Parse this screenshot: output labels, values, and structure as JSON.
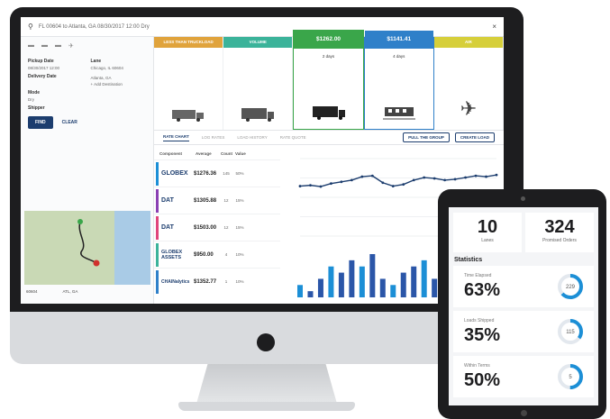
{
  "app": {
    "search_text": "FL 00604 to Atlanta, GA 08/30/2017 12:00 Dry"
  },
  "left_panel": {
    "pickup_label": "Pickup Date",
    "pickup_value": "08/30/2017 12:00",
    "lane_label": "Lane",
    "lane_origin": "Chicago, IL 60604",
    "lane_dest": "Atlanta, GA",
    "delivery_label": "Delivery Date",
    "add_destination": "+ Add Destination",
    "mode_label": "Mode",
    "mode_value": "Dry",
    "shipper_label": "Shipper",
    "find_label": "FIND",
    "clear_label": "CLEAR",
    "map_from": "60604",
    "map_to": "ATL, GA"
  },
  "mode_cards": [
    {
      "label": "LESS THAN TRUCKLOAD",
      "color": "#e0a33c"
    },
    {
      "label": "VOLUME",
      "color": "#3bb39a"
    },
    {
      "label": "$1262.00",
      "sub": "TRUCKLOAD",
      "days": "2 days",
      "color": "#3aa64a"
    },
    {
      "label": "$1141.41",
      "sub": "INTERMODAL",
      "days": "4 days",
      "color": "#2f80c9"
    },
    {
      "label": "AIR",
      "color": "#d6cf3a"
    }
  ],
  "tabs": [
    "RATE CHART",
    "LOG RATES",
    "LOAD HISTORY",
    "RATE QUOTE"
  ],
  "actions": {
    "pull_group": "PULL THE GROUP",
    "create_load": "CREATE LOAD"
  },
  "rate_headers": [
    "Component",
    "Average",
    "Count",
    "Value"
  ],
  "rates": [
    {
      "logo": "GLOBEX",
      "price": "$1276.36",
      "count": "145",
      "value": "50%",
      "color": "#1c8fd6"
    },
    {
      "logo": "DAT",
      "price": "$1305.88",
      "count": "12",
      "value": "15%",
      "color": "#8a3fb3"
    },
    {
      "logo": "DAT",
      "price": "$1503.00",
      "count": "12",
      "value": "15%",
      "color": "#e0457b"
    },
    {
      "logo": "GLOBEX ASSETS",
      "price": "$950.00",
      "count": "4",
      "value": "10%",
      "color": "#3bb39a"
    },
    {
      "logo": "CHAINalytics",
      "price": "$1352.77",
      "count": "1",
      "value": "10%",
      "color": "#2f80c9"
    }
  ],
  "tablet": {
    "lanes_value": "10",
    "lanes_label": "Lanes",
    "orders_value": "324",
    "orders_label": "Promised Orders",
    "section_title": "Statistics",
    "stats": [
      {
        "label": "Time Elapsed",
        "value": "63%",
        "ring": "229",
        "fraction": 0.63
      },
      {
        "label": "Loads Shipped",
        "value": "35%",
        "ring": "115",
        "fraction": 0.35
      },
      {
        "label": "Within Terms",
        "value": "50%",
        "ring": "5",
        "fraction": 0.5
      }
    ]
  },
  "chart_data": {
    "type": "line",
    "x": [
      1,
      2,
      3,
      4,
      5,
      6,
      7,
      8,
      9,
      10,
      11,
      12,
      13,
      14,
      15,
      16,
      17,
      18,
      19,
      20
    ],
    "series": [
      {
        "values": [
          1180,
          1190,
          1175,
          1210,
          1230,
          1250,
          1290,
          1300,
          1220,
          1180,
          1200,
          1250,
          1280,
          1270,
          1250,
          1260,
          1280,
          1300,
          1290,
          1310
        ]
      }
    ],
    "bars": [
      2,
      1,
      3,
      5,
      4,
      6,
      5,
      7,
      3,
      2,
      4,
      5,
      6,
      3,
      2,
      4,
      3,
      5,
      6,
      4
    ],
    "ylim": [
      600,
      1500
    ]
  }
}
